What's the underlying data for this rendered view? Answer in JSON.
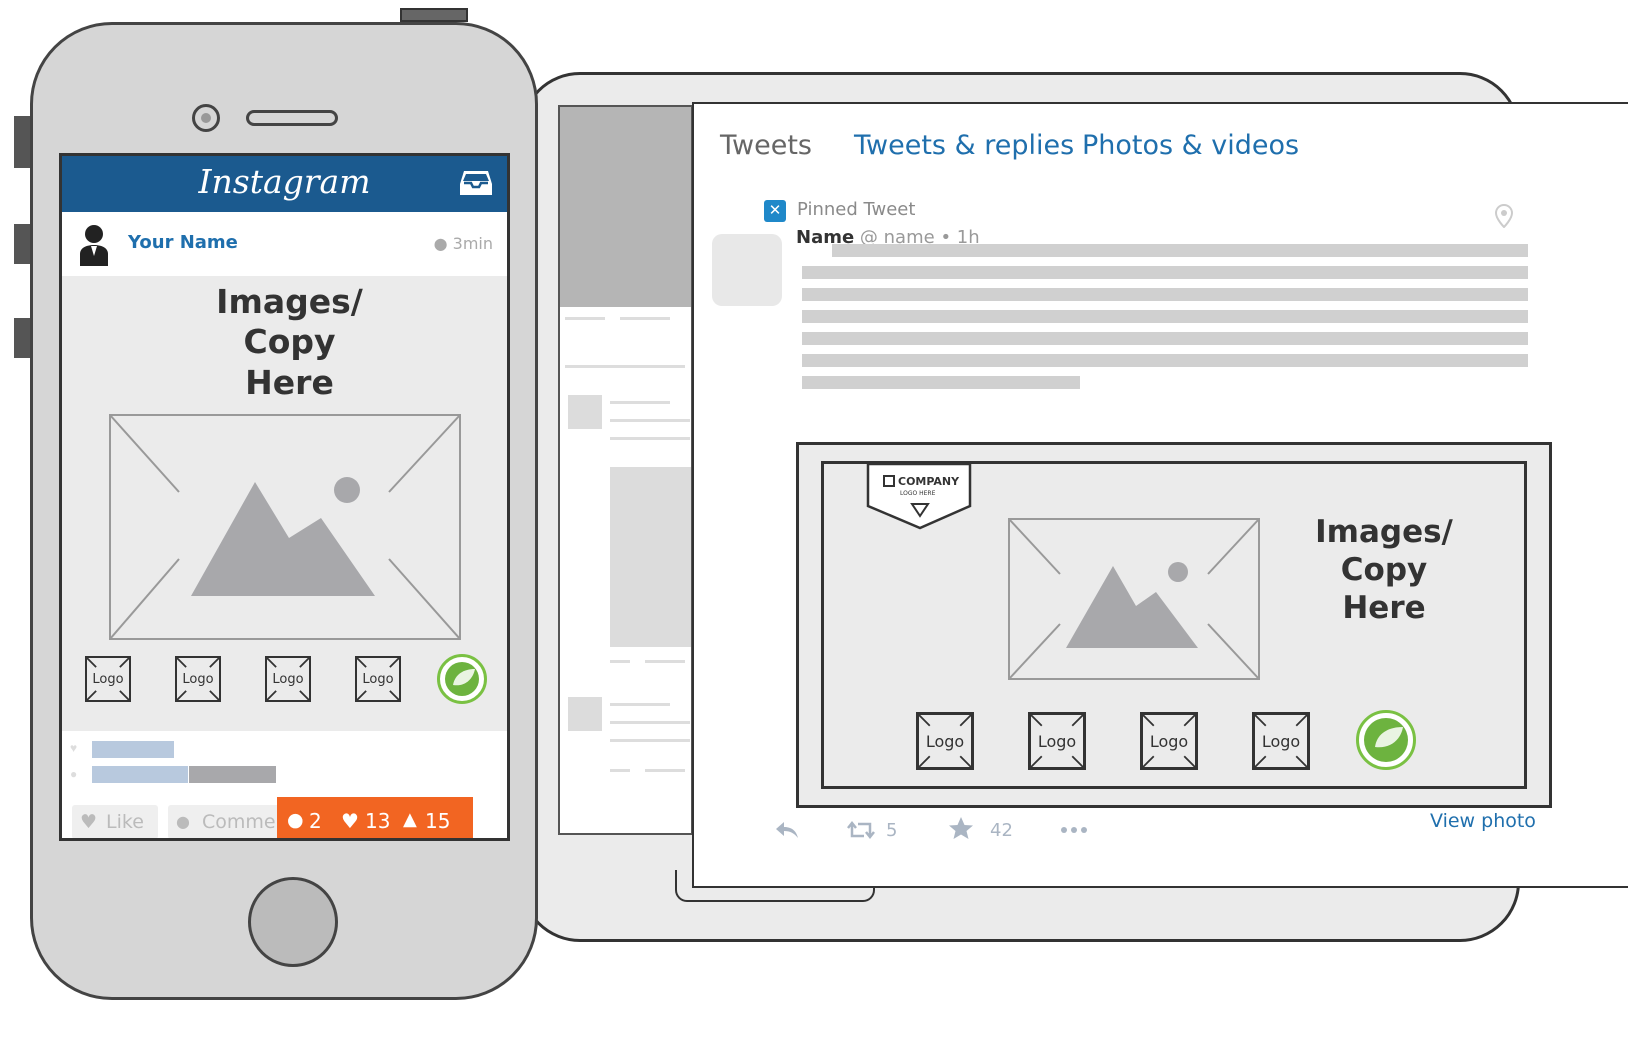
{
  "twitter": {
    "tabs": [
      {
        "label": "Tweets"
      },
      {
        "label": "Tweets & replies"
      },
      {
        "label": "Photos & videos"
      }
    ],
    "pinned_label": "Pinned Tweet",
    "author_name": "Name",
    "author_handle": "@ name",
    "time": "• 1h",
    "media": {
      "company_logo_text": "COMPANY",
      "company_logo_sub": "LOGO HERE",
      "copy_text": "Images/\nCopy\nHere",
      "logos": [
        "Logo",
        "Logo",
        "Logo",
        "Logo"
      ]
    },
    "actions": {
      "retweet_count": "5",
      "like_count": "42",
      "view_photo": "View photo"
    },
    "colors": {
      "link": "#1f6fad",
      "pin": "#1f88c9"
    }
  },
  "instagram": {
    "app_title": "Instagram",
    "user_name": "Your Name",
    "time": "3min",
    "copy_text": "Images/\nCopy\nHere",
    "logos": [
      "Logo",
      "Logo",
      "Logo",
      "Logo"
    ],
    "like_label": "Like",
    "comment_label": "Comme",
    "counts": {
      "comments": "2",
      "likes": "13",
      "followers": "15"
    },
    "colors": {
      "header": "#1b5a8f",
      "counts_bg": "#f26522",
      "badge": "#7ac143"
    }
  },
  "icons": [
    "pin-icon",
    "location-icon",
    "reply-icon",
    "retweet-icon",
    "star-icon",
    "more-icon",
    "inbox-icon",
    "clock-icon",
    "heart-icon",
    "comment-icon",
    "person-icon",
    "image-placeholder-icon"
  ]
}
